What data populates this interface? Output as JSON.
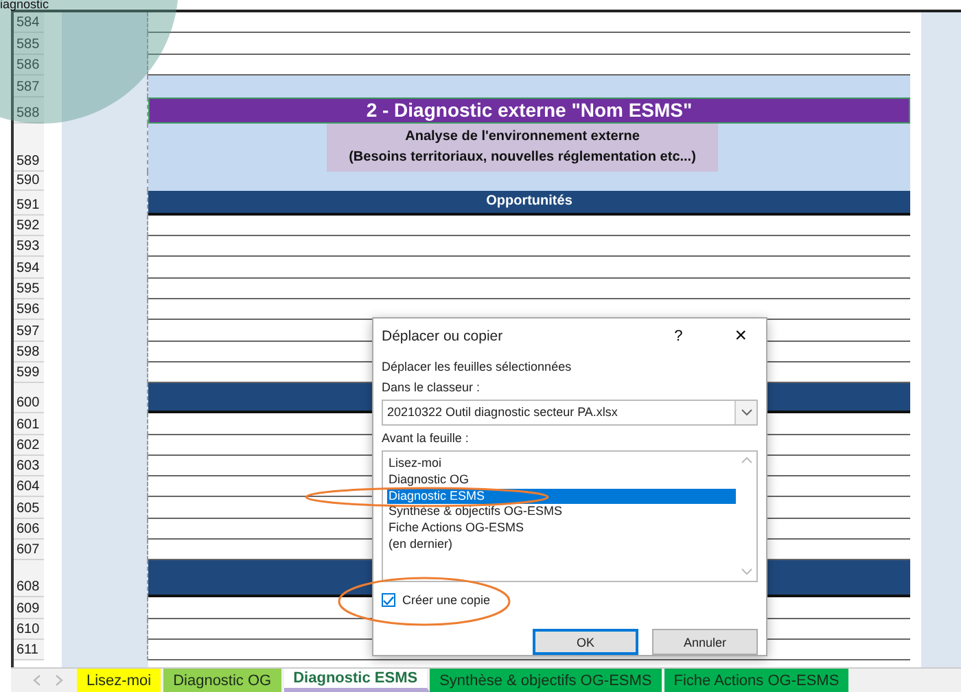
{
  "slide_title_fragment": "iagnostic",
  "rows": [
    {
      "number": "584",
      "kind": "blank"
    },
    {
      "number": "585",
      "kind": "blank"
    },
    {
      "number": "586",
      "kind": "blank"
    },
    {
      "number": "587",
      "kind": "band"
    },
    {
      "number": "588",
      "kind": "title",
      "text": "2 - Diagnostic externe \"Nom ESMS\""
    },
    {
      "number": "589",
      "kind": "subtitle",
      "lines": [
        "Analyse de l'environnement externe",
        "(Besoins territoriaux, nouvelles réglementation etc...)"
      ]
    },
    {
      "number": "590",
      "kind": "band"
    },
    {
      "number": "591",
      "kind": "section",
      "text": "Opportunités"
    },
    {
      "number": "592",
      "kind": "blank"
    },
    {
      "number": "593",
      "kind": "blank"
    },
    {
      "number": "594",
      "kind": "blank"
    },
    {
      "number": "595",
      "kind": "blank"
    },
    {
      "number": "596",
      "kind": "blank"
    },
    {
      "number": "597",
      "kind": "blank"
    },
    {
      "number": "598",
      "kind": "blank"
    },
    {
      "number": "599",
      "kind": "blank"
    },
    {
      "number": "600",
      "kind": "section"
    },
    {
      "number": "601",
      "kind": "blank"
    },
    {
      "number": "602",
      "kind": "blank"
    },
    {
      "number": "603",
      "kind": "blank"
    },
    {
      "number": "604",
      "kind": "blank"
    },
    {
      "number": "605",
      "kind": "blank"
    },
    {
      "number": "606",
      "kind": "blank"
    },
    {
      "number": "607",
      "kind": "blank"
    },
    {
      "number": "608",
      "kind": "section"
    },
    {
      "number": "609",
      "kind": "blank"
    },
    {
      "number": "610",
      "kind": "blank"
    },
    {
      "number": "611",
      "kind": "blank"
    }
  ],
  "dialog": {
    "title": "Déplacer ou copier",
    "help": "?",
    "close": "×",
    "instruction": "Déplacer les feuilles sélectionnées",
    "workbook_label": "Dans le classeur :",
    "workbook_value": "20210322 Outil diagnostic secteur PA.xlsx",
    "before_label": "Avant la feuille :",
    "sheets": [
      {
        "label": "Lisez-moi",
        "selected": false
      },
      {
        "label": "Diagnostic OG",
        "selected": false
      },
      {
        "label": "Diagnostic ESMS",
        "selected": true
      },
      {
        "label": "Synthèse & objectifs OG-ESMS",
        "selected": false
      },
      {
        "label": "Fiche Actions OG-ESMS",
        "selected": false
      },
      {
        "label": "(en dernier)",
        "selected": false
      }
    ],
    "copy_checkbox": {
      "label": "Créer une copie",
      "checked": true
    },
    "buttons": [
      "OK",
      "Annuler"
    ]
  },
  "tabs": [
    {
      "label": "Lisez-moi",
      "color": "#ffff00",
      "selected": false
    },
    {
      "label": "Diagnostic OG",
      "color": "#92d050",
      "selected": false
    },
    {
      "label": "Diagnostic ESMS",
      "color": "#b4a7d6",
      "selected": true
    },
    {
      "label": "Synthèse & objectifs OG-ESMS",
      "color": "#00b050",
      "selected": false
    },
    {
      "label": "Fiche Actions OG-ESMS",
      "color": "#00b050",
      "selected": false
    }
  ]
}
